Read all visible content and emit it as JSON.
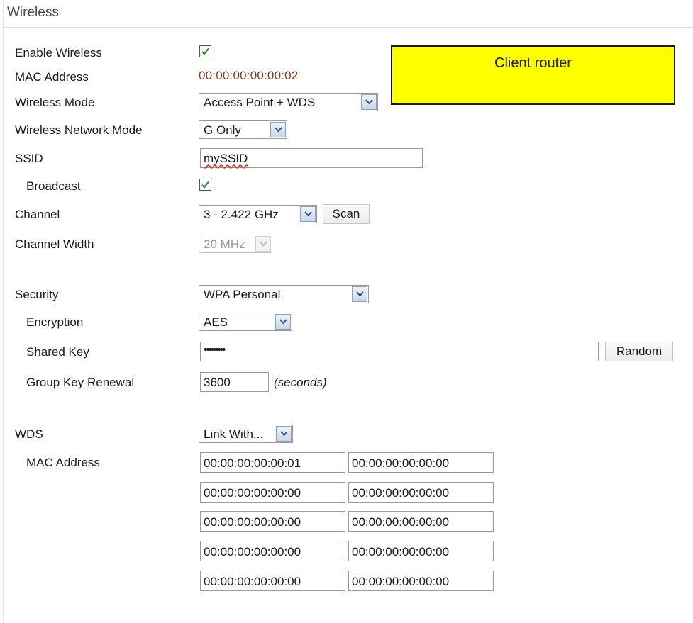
{
  "section": {
    "title": "Wireless"
  },
  "annotation": {
    "text": "Client router"
  },
  "labels": {
    "enable_wireless": "Enable Wireless",
    "mac_address": "MAC Address",
    "wireless_mode": "Wireless Mode",
    "wireless_network_mode": "Wireless Network Mode",
    "ssid": "SSID",
    "broadcast": "Broadcast",
    "channel": "Channel",
    "channel_width": "Channel Width",
    "security": "Security",
    "encryption": "Encryption",
    "shared_key": "Shared Key",
    "group_key_renewal": "Group Key Renewal",
    "wds": "WDS",
    "wds_mac_address": "MAC Address"
  },
  "values": {
    "enable_wireless_checked": true,
    "mac_address": "00:00:00:00:00:02",
    "wireless_mode": "Access Point + WDS",
    "wireless_network_mode": "G Only",
    "ssid": "mySSID",
    "broadcast_checked": true,
    "channel": "3 - 2.422 GHz",
    "channel_width": "20 MHz",
    "security": "WPA Personal",
    "encryption": "AES",
    "shared_key": "•••••••••",
    "group_key_renewal": "3600",
    "group_key_renewal_unit": "(seconds)",
    "wds": "Link With..."
  },
  "buttons": {
    "scan": "Scan",
    "random": "Random"
  },
  "wds_macs": [
    [
      "00:00:00:00:00:01",
      "00:00:00:00:00:00"
    ],
    [
      "00:00:00:00:00:00",
      "00:00:00:00:00:00"
    ],
    [
      "00:00:00:00:00:00",
      "00:00:00:00:00:00"
    ],
    [
      "00:00:00:00:00:00",
      "00:00:00:00:00:00"
    ],
    [
      "00:00:00:00:00:00",
      "00:00:00:00:00:00"
    ]
  ],
  "colors": {
    "mac_text": "#8b3a1f",
    "annotation_bg": "#ffff00",
    "checkmark": "#2d8a2d"
  }
}
